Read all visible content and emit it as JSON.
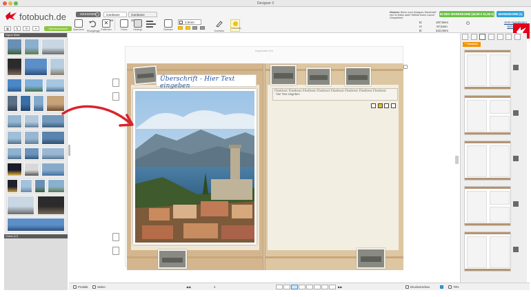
{
  "window": {
    "title": "Designer 3"
  },
  "logo": {
    "brand": "fotobuch.de"
  },
  "header": {
    "designer_label": "DESIGNER",
    "tabs": [
      "Gardasee 2016",
      "Gardasee 2016_2"
    ],
    "tools": [
      "Speichern",
      "Rückgängig",
      "Entfernen",
      "Farbe",
      "Hintergr.",
      "Ebenen",
      "Text",
      "Formen",
      "Rahmen",
      "Korrektur",
      "Vorschau"
    ],
    "stroke_value": "2,0mm",
    "notice_bold": "Hinweis:",
    "notice_text": "Wenn noch Designer-Sicherheit* hier im Editor aktiv* Effekte freien Lizenz* Gespeichert",
    "price_button": "IN DEN WARENKORB (49,99 € 51,95 €)",
    "cart_button": "WARENKORB (1)",
    "measures": [
      {
        "label": "B:",
        "value": "197,9mm",
        "label2": "H:",
        "value2": "57,5mm"
      },
      {
        "label": "B:",
        "value": "222,0mm",
        "label2": "V:",
        "value2": "12,1mm"
      }
    ],
    "links": [
      "Jetzt registrieren!",
      "Sicheren Login"
    ],
    "left_mini": [
      "Tabellenansicht"
    ]
  },
  "left_panel": {
    "header": "Eigene Bilder",
    "footer": "Ordner (17)"
  },
  "spread": {
    "hint": "Doppelseite 5/14",
    "heading": "Überschrift - Hier Text eingeben",
    "textbox_lines": [
      "Fließtext Fließtext Fließtext Fließtext Fließtext Fließtext Fließtext Fließtext",
      "- hier Text eingeben"
    ]
  },
  "right_panel": {
    "tab_label": "\"\" Zentrum"
  },
  "bottom_bar": {
    "product": "Produkt",
    "pages": "Seiten",
    "page_counter": "4",
    "print_preview": "Druckvorschau",
    "zoom": "79%"
  },
  "colors": {
    "accent_green": "#6cc04a",
    "accent_blue": "#2da3d9",
    "brand_red": "#e2001a",
    "tab_orange": "#f39200",
    "heading_blue": "#1e4e9a",
    "arrow_red": "#d8242d"
  }
}
